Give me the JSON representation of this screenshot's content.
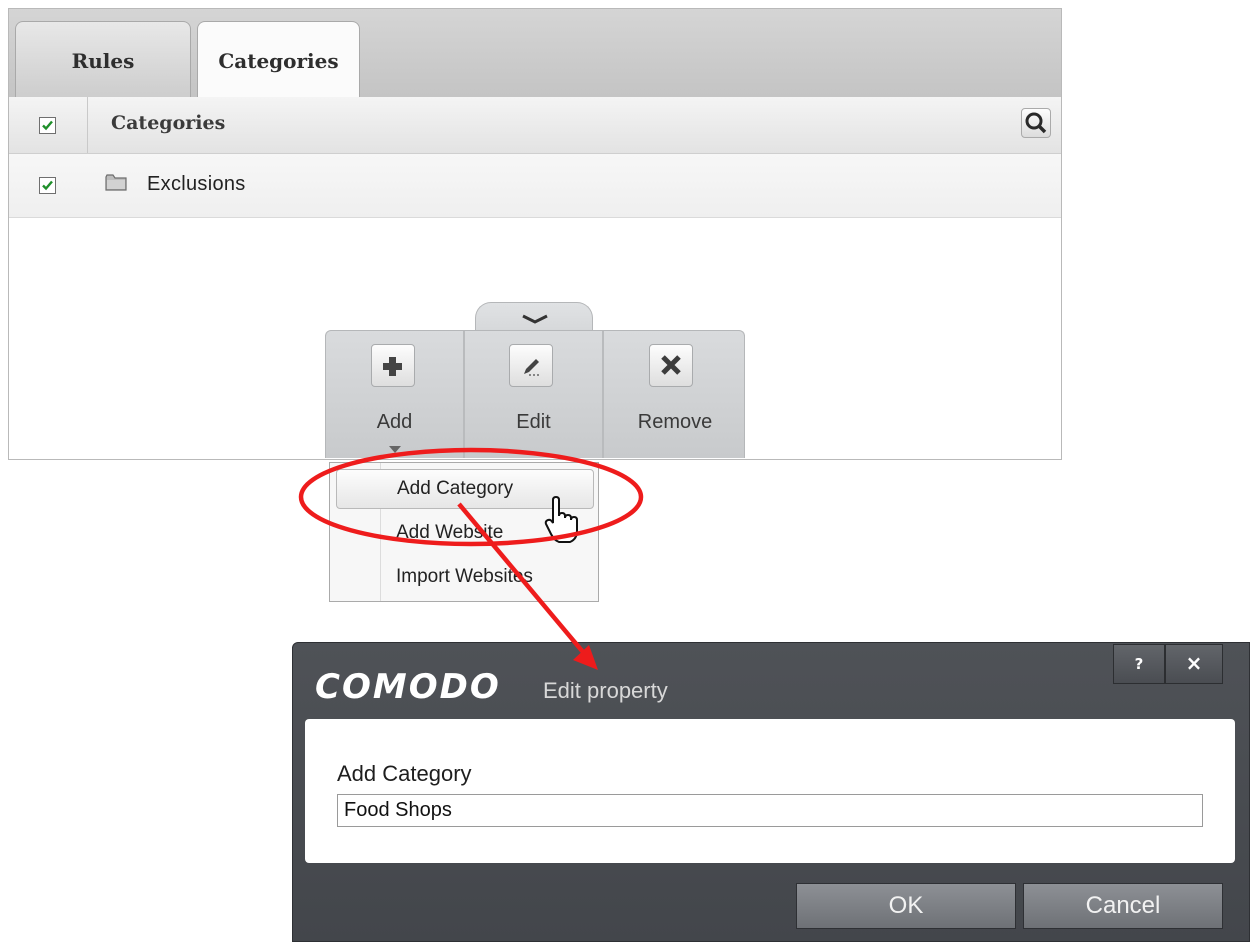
{
  "tabs": [
    {
      "label": "Rules"
    },
    {
      "label": "Categories"
    }
  ],
  "table": {
    "header": "Categories",
    "rows": [
      {
        "label": "Exclusions"
      }
    ]
  },
  "toolbar": {
    "add": "Add",
    "edit": "Edit",
    "remove": "Remove"
  },
  "add_menu": {
    "items": [
      "Add Category",
      "Add Website",
      "Import Websites"
    ],
    "highlighted": "Add Category"
  },
  "dialog": {
    "brand": "COMODO",
    "title": "Edit property",
    "help_label": "?",
    "close_label": "×",
    "field_label": "Add Category",
    "field_value": "Food Shops",
    "ok_label": "OK",
    "cancel_label": "Cancel"
  },
  "colors": {
    "annotation": "#ee1c1c",
    "checkmark": "#1f8f2a",
    "dialog_bg": "#4b4e53"
  }
}
